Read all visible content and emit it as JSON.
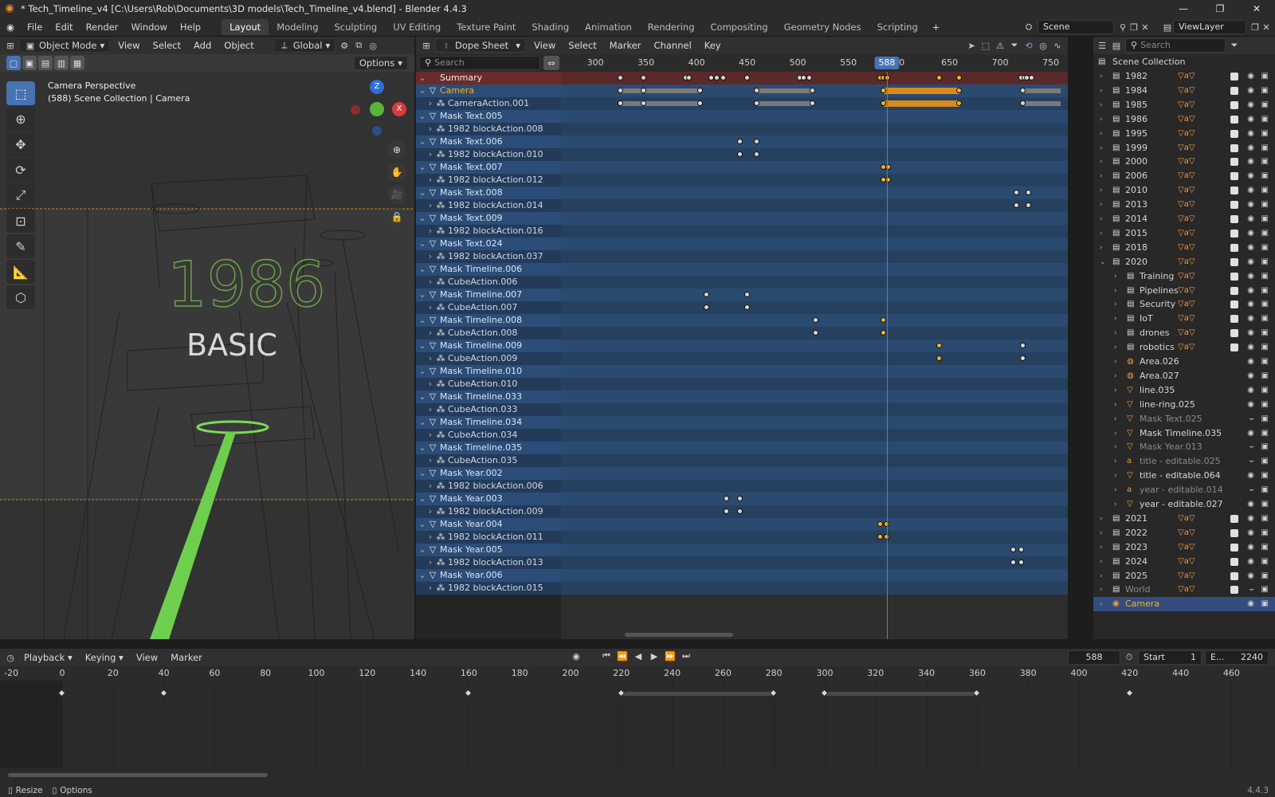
{
  "window": {
    "title": "* Tech_Timeline_v4 [C:\\Users\\Rob\\Documents\\3D models\\Tech_Timeline_v4.blend] - Blender 4.4.3",
    "controls": [
      "—",
      "❐",
      "✕"
    ]
  },
  "menus": [
    "File",
    "Edit",
    "Render",
    "Window",
    "Help"
  ],
  "workspaces": [
    "Layout",
    "Modeling",
    "Sculpting",
    "UV Editing",
    "Texture Paint",
    "Shading",
    "Animation",
    "Rendering",
    "Compositing",
    "Geometry Nodes",
    "Scripting"
  ],
  "active_workspace": "Layout",
  "scene": {
    "name": "Scene",
    "view_layer": "ViewLayer"
  },
  "viewport": {
    "mode": "Object Mode",
    "menus": [
      "View",
      "Select",
      "Add",
      "Object"
    ],
    "orientation": "Global",
    "options_label": "Options",
    "view_name": "Camera Perspective",
    "view_info": "(588) Scene Collection | Camera",
    "scene_text_year": "1986",
    "scene_text_title": "BASIC",
    "gizmo": {
      "z": "Z",
      "x": "X"
    }
  },
  "dopesheet": {
    "mode": "Dope Sheet",
    "menus": [
      "View",
      "Select",
      "Marker",
      "Channel",
      "Key"
    ],
    "search_placeholder": "Search",
    "current_frame": "588",
    "ruler_ticks": [
      {
        "label": "300",
        "frame": 300
      },
      {
        "label": "350",
        "frame": 350
      },
      {
        "label": "400",
        "frame": 400
      },
      {
        "label": "450",
        "frame": 450
      },
      {
        "label": "500",
        "frame": 500
      },
      {
        "label": "550",
        "frame": 550
      },
      {
        "label": "00",
        "frame": 600
      },
      {
        "label": "650",
        "frame": 650
      },
      {
        "label": "700",
        "frame": 700
      },
      {
        "label": "750",
        "frame": 750
      }
    ],
    "channels": [
      {
        "name": "Summary",
        "kind": "sum",
        "keys": [
          325,
          348,
          390,
          393,
          415,
          420,
          427,
          450,
          502,
          506,
          512,
          582,
          585,
          588,
          589,
          640,
          660,
          721,
          724,
          727,
          731
        ],
        "bars": [],
        "sel": [
          582,
          585,
          588,
          589,
          640,
          660
        ]
      },
      {
        "name": "Camera",
        "kind": "obj",
        "keys": [
          325,
          348,
          404,
          460,
          515,
          585,
          660,
          723
        ],
        "bars": [
          [
            325,
            348
          ],
          [
            348,
            404
          ],
          [
            460,
            515
          ],
          [
            723,
            760
          ]
        ],
        "sel": [
          585,
          660
        ],
        "selbars": [
          [
            585,
            660
          ]
        ]
      },
      {
        "name": "CameraAction.001",
        "kind": "act",
        "keys": [
          325,
          348,
          404,
          460,
          515,
          585,
          660,
          723
        ],
        "bars": [
          [
            325,
            348
          ],
          [
            348,
            404
          ],
          [
            460,
            515
          ],
          [
            723,
            760
          ]
        ],
        "sel": [
          585,
          660
        ],
        "selbars": [
          [
            585,
            660
          ]
        ]
      },
      {
        "name": "Mask Text.005",
        "kind": "obj",
        "keys": [],
        "bars": [],
        "sel": []
      },
      {
        "name": "1982 blockAction.008",
        "kind": "act",
        "keys": [],
        "bars": [],
        "sel": []
      },
      {
        "name": "Mask Text.006",
        "kind": "obj",
        "keys": [
          443,
          460
        ],
        "bars": [],
        "sel": []
      },
      {
        "name": "1982 blockAction.010",
        "kind": "act",
        "keys": [
          443,
          460
        ],
        "bars": [],
        "sel": []
      },
      {
        "name": "Mask Text.007",
        "kind": "obj",
        "keys": [
          585,
          590
        ],
        "bars": [],
        "sel": [
          585,
          590
        ]
      },
      {
        "name": "1982 blockAction.012",
        "kind": "act",
        "keys": [
          585,
          590
        ],
        "bars": [],
        "sel": [
          585,
          590
        ]
      },
      {
        "name": "Mask Text.008",
        "kind": "obj",
        "keys": [
          716,
          728
        ],
        "bars": [],
        "sel": []
      },
      {
        "name": "1982 blockAction.014",
        "kind": "act",
        "keys": [
          716,
          728
        ],
        "bars": [],
        "sel": []
      },
      {
        "name": "Mask Text.009",
        "kind": "obj",
        "keys": [],
        "bars": [],
        "sel": []
      },
      {
        "name": "1982 blockAction.016",
        "kind": "act",
        "keys": [],
        "bars": [],
        "sel": []
      },
      {
        "name": "Mask Text.024",
        "kind": "obj",
        "keys": [],
        "bars": [],
        "sel": []
      },
      {
        "name": "1982 blockAction.037",
        "kind": "act",
        "keys": [],
        "bars": [],
        "sel": []
      },
      {
        "name": "Mask Timeline.006",
        "kind": "obj",
        "keys": [],
        "bars": [],
        "sel": []
      },
      {
        "name": "CubeAction.006",
        "kind": "act",
        "keys": [],
        "bars": [],
        "sel": []
      },
      {
        "name": "Mask Timeline.007",
        "kind": "obj",
        "keys": [
          410,
          450
        ],
        "bars": [],
        "sel": []
      },
      {
        "name": "CubeAction.007",
        "kind": "act",
        "keys": [
          410,
          450
        ],
        "bars": [],
        "sel": []
      },
      {
        "name": "Mask Timeline.008",
        "kind": "obj",
        "keys": [
          518,
          585
        ],
        "bars": [],
        "sel": [
          585
        ]
      },
      {
        "name": "CubeAction.008",
        "kind": "act",
        "keys": [
          518,
          585
        ],
        "bars": [],
        "sel": [
          585
        ]
      },
      {
        "name": "Mask Timeline.009",
        "kind": "obj",
        "keys": [
          640,
          723
        ],
        "bars": [],
        "sel": [
          640
        ]
      },
      {
        "name": "CubeAction.009",
        "kind": "act",
        "keys": [
          640,
          723
        ],
        "bars": [],
        "sel": [
          640
        ]
      },
      {
        "name": "Mask Timeline.010",
        "kind": "obj",
        "keys": [],
        "bars": [],
        "sel": []
      },
      {
        "name": "CubeAction.010",
        "kind": "act",
        "keys": [],
        "bars": [],
        "sel": []
      },
      {
        "name": "Mask Timeline.033",
        "kind": "obj",
        "keys": [],
        "bars": [],
        "sel": []
      },
      {
        "name": "CubeAction.033",
        "kind": "act",
        "keys": [],
        "bars": [],
        "sel": []
      },
      {
        "name": "Mask Timeline.034",
        "kind": "obj",
        "keys": [],
        "bars": [],
        "sel": []
      },
      {
        "name": "CubeAction.034",
        "kind": "act",
        "keys": [],
        "bars": [],
        "sel": []
      },
      {
        "name": "Mask Timeline.035",
        "kind": "obj",
        "keys": [],
        "bars": [],
        "sel": []
      },
      {
        "name": "CubeAction.035",
        "kind": "act",
        "keys": [],
        "bars": [],
        "sel": []
      },
      {
        "name": "Mask Year.002",
        "kind": "obj",
        "keys": [],
        "bars": [],
        "sel": []
      },
      {
        "name": "1982 blockAction.006",
        "kind": "act",
        "keys": [],
        "bars": [],
        "sel": []
      },
      {
        "name": "Mask Year.003",
        "kind": "obj",
        "keys": [
          430,
          443
        ],
        "bars": [],
        "sel": []
      },
      {
        "name": "1982 blockAction.009",
        "kind": "act",
        "keys": [
          430,
          443
        ],
        "bars": [],
        "sel": []
      },
      {
        "name": "Mask Year.004",
        "kind": "obj",
        "keys": [
          582,
          588
        ],
        "bars": [],
        "sel": [
          582,
          588
        ]
      },
      {
        "name": "1982 blockAction.011",
        "kind": "act",
        "keys": [
          582,
          588
        ],
        "bars": [],
        "sel": [
          582,
          588
        ]
      },
      {
        "name": "Mask Year.005",
        "kind": "obj",
        "keys": [
          713,
          721
        ],
        "bars": [],
        "sel": []
      },
      {
        "name": "1982 blockAction.013",
        "kind": "act",
        "keys": [
          713,
          721
        ],
        "bars": [],
        "sel": []
      },
      {
        "name": "Mask Year.006",
        "kind": "obj",
        "keys": [],
        "bars": [],
        "sel": []
      },
      {
        "name": "1982 blockAction.015",
        "kind": "act",
        "keys": [],
        "bars": [],
        "sel": []
      }
    ]
  },
  "outliner": {
    "search_placeholder": "Search",
    "root": "Scene Collection",
    "items": [
      {
        "name": "1982",
        "depth": 0,
        "type": "collection",
        "visible": true,
        "checked": true
      },
      {
        "name": "1984",
        "depth": 0,
        "type": "collection",
        "visible": true,
        "checked": true
      },
      {
        "name": "1985",
        "depth": 0,
        "type": "collection",
        "visible": true,
        "checked": true
      },
      {
        "name": "1986",
        "depth": 0,
        "type": "collection",
        "visible": true,
        "checked": true
      },
      {
        "name": "1995",
        "depth": 0,
        "type": "collection",
        "visible": true,
        "checked": true
      },
      {
        "name": "1999",
        "depth": 0,
        "type": "collection",
        "visible": true,
        "checked": true
      },
      {
        "name": "2000",
        "depth": 0,
        "type": "collection",
        "visible": true,
        "checked": true
      },
      {
        "name": "2006",
        "depth": 0,
        "type": "collection",
        "visible": true,
        "checked": true
      },
      {
        "name": "2010",
        "depth": 0,
        "type": "collection",
        "visible": true,
        "checked": true
      },
      {
        "name": "2013",
        "depth": 0,
        "type": "collection",
        "visible": true,
        "checked": true
      },
      {
        "name": "2014",
        "depth": 0,
        "type": "collection",
        "visible": true,
        "checked": true
      },
      {
        "name": "2015",
        "depth": 0,
        "type": "collection",
        "visible": true,
        "checked": true
      },
      {
        "name": "2018",
        "depth": 0,
        "type": "collection",
        "visible": true,
        "checked": true
      },
      {
        "name": "2020",
        "depth": 0,
        "type": "collection",
        "visible": true,
        "checked": true,
        "expanded": true
      },
      {
        "name": "Training",
        "depth": 1,
        "type": "collection",
        "visible": true,
        "checked": true
      },
      {
        "name": "Pipelines",
        "depth": 1,
        "type": "collection",
        "visible": true,
        "checked": true
      },
      {
        "name": "Security",
        "depth": 1,
        "type": "collection",
        "visible": true,
        "checked": true
      },
      {
        "name": "IoT",
        "depth": 1,
        "type": "collection",
        "visible": true,
        "checked": true
      },
      {
        "name": "drones",
        "depth": 1,
        "type": "collection",
        "visible": true,
        "checked": true
      },
      {
        "name": "robotics",
        "depth": 1,
        "type": "collection",
        "visible": true,
        "checked": true
      },
      {
        "name": "Area.026",
        "depth": 1,
        "type": "light",
        "visible": true,
        "checked": false
      },
      {
        "name": "Area.027",
        "depth": 1,
        "type": "light",
        "visible": true,
        "checked": false
      },
      {
        "name": "line.035",
        "depth": 1,
        "type": "mesh",
        "visible": true,
        "checked": false
      },
      {
        "name": "line-ring.025",
        "depth": 1,
        "type": "mesh",
        "visible": true,
        "checked": false
      },
      {
        "name": "Mask Text.025",
        "depth": 1,
        "type": "mesh",
        "visible": false,
        "checked": false
      },
      {
        "name": "Mask Timeline.035",
        "depth": 1,
        "type": "mesh",
        "visible": true,
        "checked": false
      },
      {
        "name": "Mask Year.013",
        "depth": 1,
        "type": "mesh",
        "visible": false,
        "checked": false
      },
      {
        "name": "title - editable.025",
        "depth": 1,
        "type": "text",
        "visible": false,
        "checked": false
      },
      {
        "name": "title - editable.064",
        "depth": 1,
        "type": "mesh",
        "visible": true,
        "checked": false
      },
      {
        "name": "year - editable.014",
        "depth": 1,
        "type": "text",
        "visible": false,
        "checked": false
      },
      {
        "name": "year - editable.027",
        "depth": 1,
        "type": "mesh",
        "visible": true,
        "checked": false
      },
      {
        "name": "2021",
        "depth": 0,
        "type": "collection",
        "visible": true,
        "checked": true
      },
      {
        "name": "2022",
        "depth": 0,
        "type": "collection",
        "visible": true,
        "checked": true
      },
      {
        "name": "2023",
        "depth": 0,
        "type": "collection",
        "visible": true,
        "checked": true
      },
      {
        "name": "2024",
        "depth": 0,
        "type": "collection",
        "visible": true,
        "checked": true
      },
      {
        "name": "2025",
        "depth": 0,
        "type": "collection",
        "visible": true,
        "checked": true
      },
      {
        "name": "World",
        "depth": 0,
        "type": "collection",
        "visible": false,
        "checked": true
      },
      {
        "name": "Camera",
        "depth": 0,
        "type": "camera",
        "visible": true,
        "checked": false,
        "selected": true
      }
    ]
  },
  "timeline": {
    "menus": [
      "Playback",
      "Keying",
      "View",
      "Marker"
    ],
    "current_frame": "588",
    "start_label": "Start",
    "start": "1",
    "end_label": "E...",
    "end": "2240",
    "ticks": [
      "-20",
      "0",
      "20",
      "40",
      "60",
      "80",
      "100",
      "120",
      "140",
      "160",
      "180",
      "200",
      "220",
      "240",
      "260",
      "280",
      "300",
      "320",
      "340",
      "360",
      "380",
      "400",
      "420",
      "440",
      "460"
    ],
    "keys": [
      0,
      40,
      160,
      220,
      280,
      300,
      360,
      420
    ],
    "holds": [
      [
        220,
        280
      ],
      [
        300,
        360
      ]
    ]
  },
  "status": {
    "resize": "Resize",
    "options": "Options",
    "version": "4.4.3"
  },
  "colors": {
    "accent": "#4772b3",
    "selected_key": "#f0b429",
    "object_row": "#2c4d78"
  }
}
